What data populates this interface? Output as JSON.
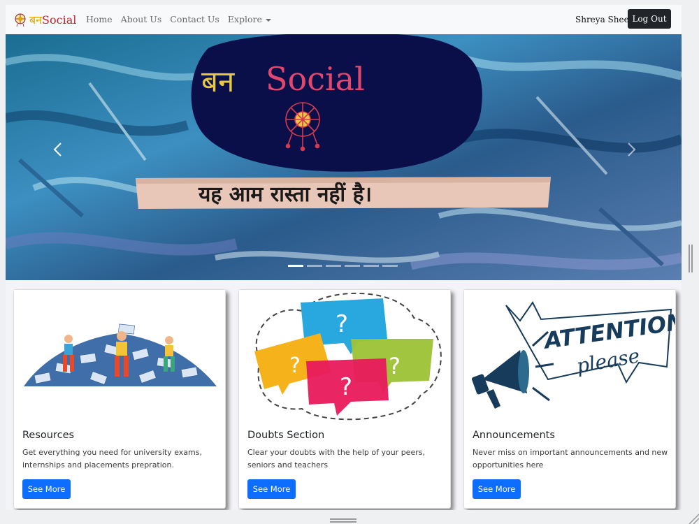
{
  "navbar": {
    "brand_hindi": "बन",
    "brand_english": "Social",
    "links": [
      "Home",
      "About Us",
      "Contact Us"
    ],
    "explore_label": "Explore",
    "user_name": "Shreya Sheel",
    "logout_label": "Log Out"
  },
  "carousel": {
    "slide_title_hindi": "बन",
    "slide_title_english": "Social",
    "tagline": "यह आम रास्ता नहीं है।",
    "active_index": 0,
    "indicator_count": 6
  },
  "cards": [
    {
      "title": "Resources",
      "text": "Get everything you need for university exams, internships and placements prepration.",
      "button": "See More"
    },
    {
      "title": "Doubts Section",
      "text": "Clear your doubts with the help of your peers, seniors and teachers",
      "button": "See More"
    },
    {
      "title": "Announcements",
      "text": "Never miss on important announcements and new opportunities here",
      "button": "See More"
    }
  ],
  "announcement_art": {
    "line1": "ATTENTION",
    "line2": "please"
  },
  "colors": {
    "primary_button": "#0d6efd",
    "dark_button": "#212529",
    "brand_hindi": "#d9a600",
    "brand_english": "#c81e2b"
  }
}
